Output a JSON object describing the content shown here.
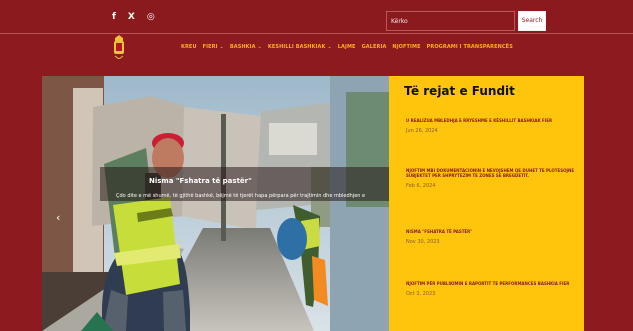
{
  "topbar": {
    "social_icons": [
      {
        "name": "facebook-icon",
        "glyph": "f"
      },
      {
        "name": "x-icon",
        "glyph": "X"
      },
      {
        "name": "instagram-icon",
        "glyph": "◎"
      }
    ],
    "search_value": "Kërko",
    "search_button": "Search"
  },
  "header": {
    "nav": [
      {
        "label": "KREU",
        "dropdown": false
      },
      {
        "label": "FIERI",
        "dropdown": true
      },
      {
        "label": "BASHKIA",
        "dropdown": true
      },
      {
        "label": "KESHILLI BASHKIAK",
        "dropdown": true
      },
      {
        "label": "LAJME",
        "dropdown": false
      },
      {
        "label": "GALERIA",
        "dropdown": false
      },
      {
        "label": "NJOFTIME",
        "dropdown": false
      },
      {
        "label": "PROGRAMI I TRANSPARENCËS",
        "dropdown": false
      }
    ]
  },
  "hero": {
    "title": "Nisma \"Fshatra të pastër\"",
    "text": "Çdo dite e më shumë, të gjithë bashkë, bëjmë të tjerët hapa përpara për trajtimin dhe mbledhjen e"
  },
  "panel": {
    "title": "Të rejat e Fundit",
    "items": [
      {
        "headline": "U REALIZUA MBLEDHJA E RRYESHME E KËSHILLIT BASHKIAK FIER",
        "date": "Jun 26, 2024"
      },
      {
        "headline": "NJOFTIM MBI DOKUMENTACIONIN E NEVOJSHEM QE DUHET TE PLOTESOJNE SUBJEKTET PER SHPRYTEZIM TE ZONES SE BREGDETIT.",
        "date": "Feb 6, 2024"
      },
      {
        "headline": "NISMA \"FSHATRA TË PASTËR\"",
        "date": "Nov 30, 2023"
      },
      {
        "headline": "NJOFTIM PËR PUBLIKIMIN E RAPORTIT TE PERFORMANCES BASHKIA FIER",
        "date": "Oct 3, 2023"
      }
    ]
  }
}
